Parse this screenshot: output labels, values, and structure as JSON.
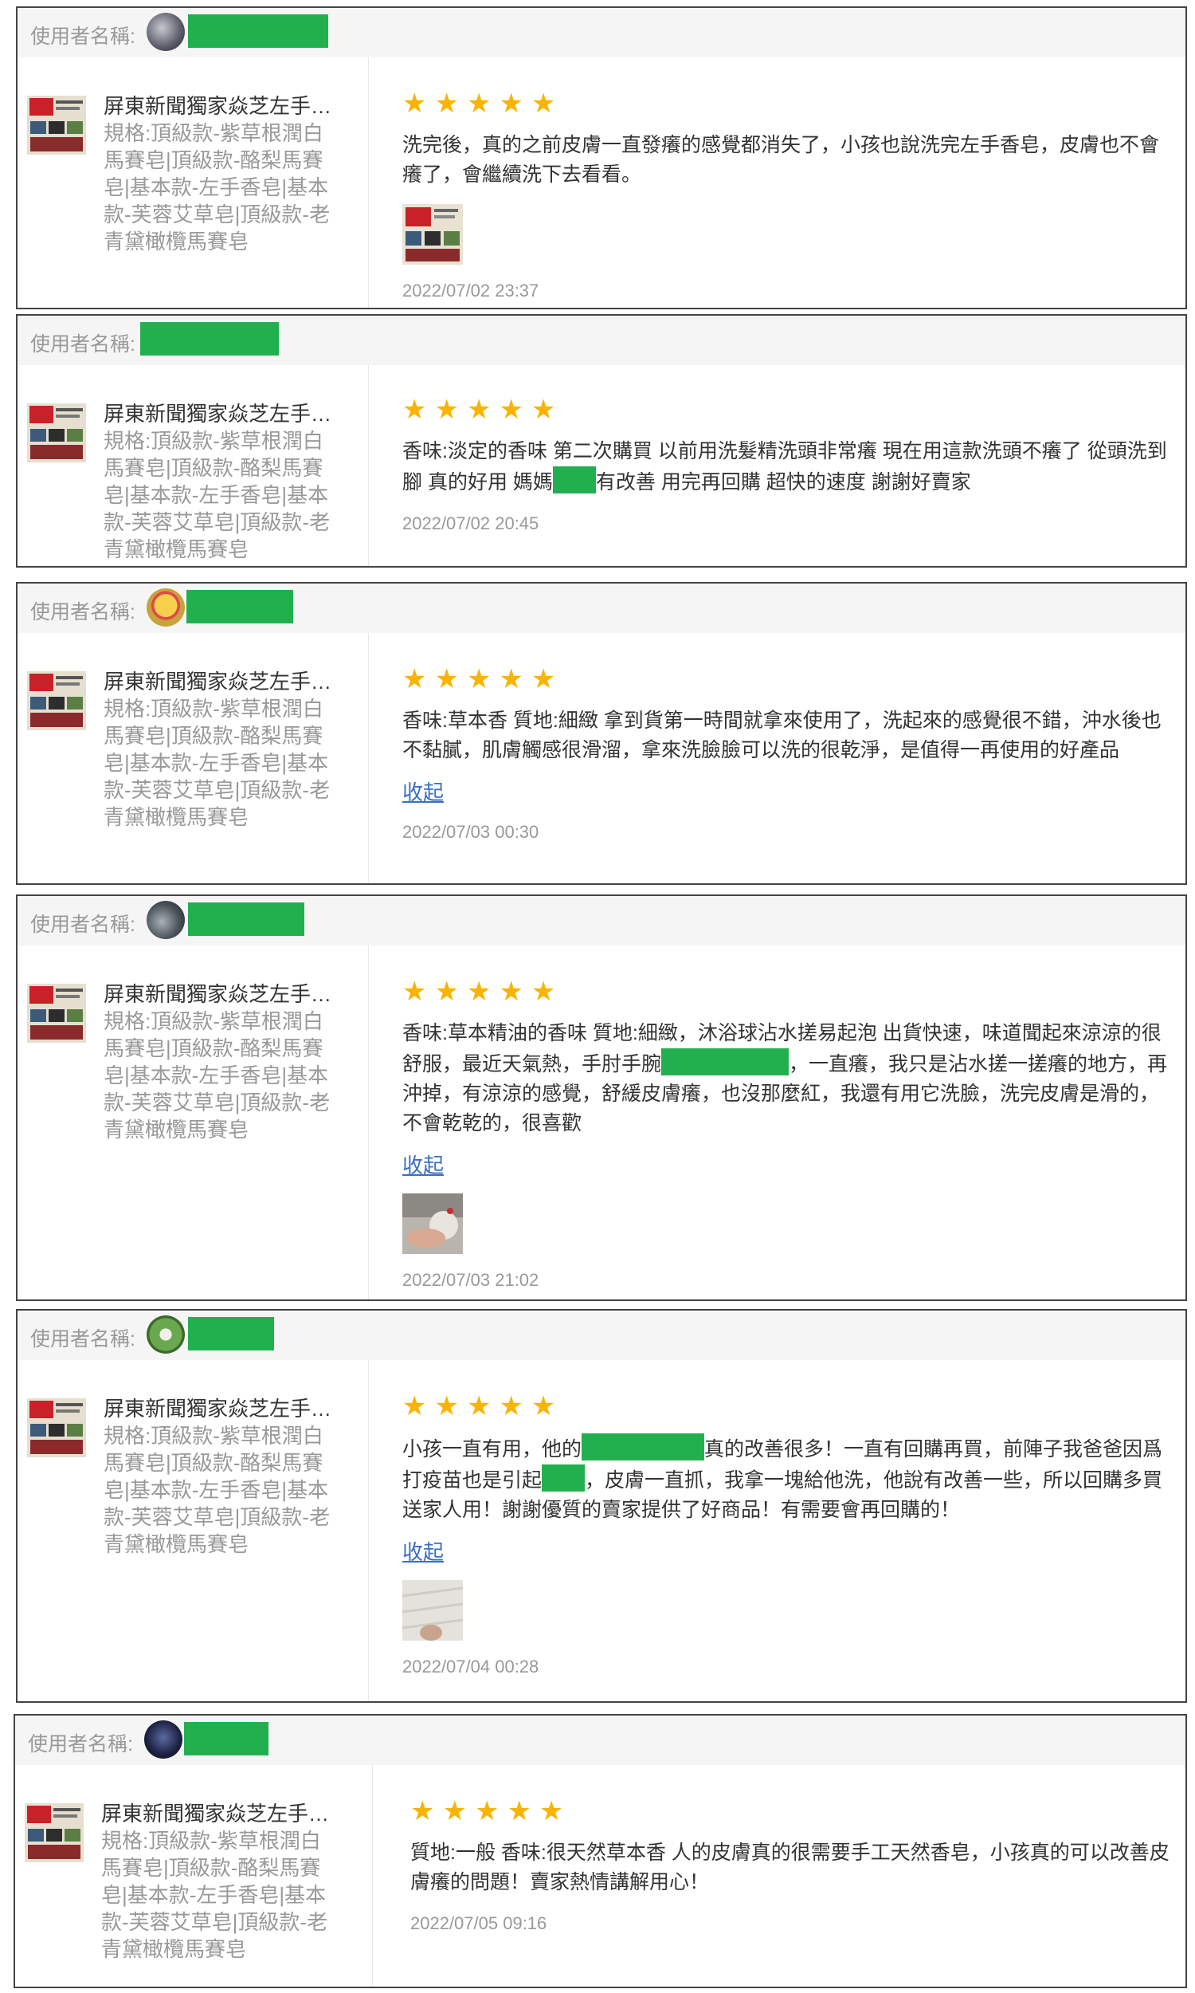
{
  "user_label": "使用者名稱:",
  "collapse_label": "收起",
  "product": {
    "name": "屏東新聞獨家焱芝左手香皂",
    "spec": "規格:頂級款-紫草根潤白馬賽皂|頂級款-酪梨馬賽皂|基本款-左手香皂|基本款-芙蓉艾草皂|頂級款-老青黛橄欖馬賽皂"
  },
  "reviews": [
    {
      "stars": "★★★★★",
      "text": "洗完後，真的之前皮膚一直發癢的感覺都消失了，小孩也說洗完左手香皂，皮膚也不會癢了，會繼續洗下去看看。",
      "date": "2022/07/02 23:37"
    },
    {
      "stars": "★★★★★",
      "text_a": "香味:淡定的香味 第二次購買 以前用洗髮精洗頭非常癢 現在用這款洗頭不癢了 從頭洗到腳 真的好用 媽媽",
      "text_b": "有改善 用完再回購 超快的速度 謝謝好賣家",
      "date": "2022/07/02 20:45"
    },
    {
      "stars": "★★★★★",
      "text": "香味:草本香 質地:細緻 拿到貨第一時間就拿來使用了，洗起來的感覺很不錯，沖水後也不黏膩，肌膚觸感很滑溜，拿來洗臉臉可以洗的很乾淨，是值得一再使用的好產品",
      "date": "2022/07/03 00:30"
    },
    {
      "stars": "★★★★★",
      "text_a": "香味:草本精油的香味 質地:細緻，沐浴球沾水搓易起泡 出貨快速，味道聞起來涼涼的很舒服，最近天氣熱，手肘手腕",
      "text_b": "，一直癢，我只是沾水搓一搓癢的地方，再沖掉，有涼涼的感覺，舒緩皮膚癢，也沒那麼紅，我還有用它洗臉，洗完皮膚是滑的，不會乾乾的，很喜歡",
      "date": "2022/07/03 21:02"
    },
    {
      "stars": "★★★★★",
      "text_a": "小孩一直有用，他的",
      "text_b": "真的改善很多！一直有回購再買，前陣子我爸爸因爲打疫苗也是引起",
      "text_c": "，皮膚一直抓，我拿一塊給他洗，他說有改善一些，所以回購多買送家人用！謝謝優質的賣家提供了好商品！有需要會再回購的！",
      "date": "2022/07/04 00:28"
    },
    {
      "stars": "★★★★★",
      "text": "質地:一般 香味:很天然草本香 人的皮膚真的很需要手工天然香皂，小孩真的可以改善皮膚癢的問題！賣家熱情講解用心！",
      "date": "2022/07/05 09:16"
    }
  ]
}
